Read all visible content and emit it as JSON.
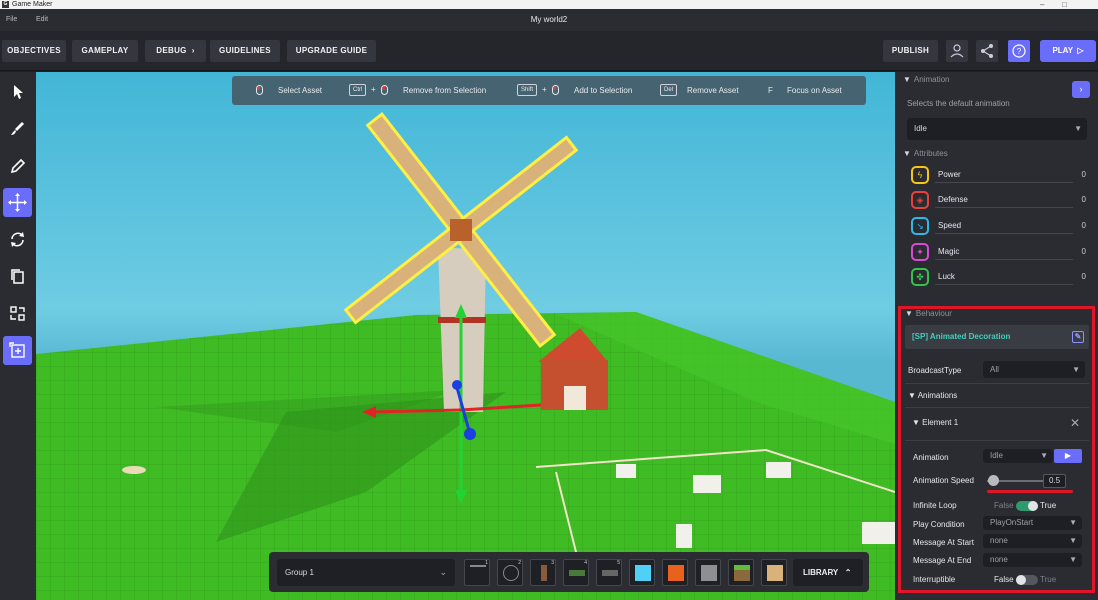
{
  "os": {
    "app_name": "Game Maker",
    "minimize": "–",
    "maximize": "□"
  },
  "menu": {
    "file": "File",
    "edit": "Edit",
    "document_title": "My world2"
  },
  "toolbar": {
    "objectives": "OBJECTIVES",
    "gameplay": "GAMEPLAY",
    "debug": "DEBUG",
    "guidelines": "GUIDELINES",
    "upgrade_guide": "UPGRADE GUIDE",
    "publish": "PUBLISH",
    "play": "PLAY",
    "accent": "#6a6dfa"
  },
  "tools": [
    "cursor-icon",
    "brush-icon",
    "eyedropper-icon",
    "move-icon",
    "rotate-icon",
    "duplicate-icon",
    "swap-icon",
    "add-group-icon"
  ],
  "hints": {
    "select": "Select Asset",
    "ctrl_key": "Ctrl",
    "remove_selection": "Remove from Selection",
    "shift_key": "Shift",
    "add_selection": "Add to Selection",
    "del_key": "Del",
    "remove_asset": "Remove Asset",
    "f_key": "F",
    "focus": "Focus on Asset"
  },
  "assetbar": {
    "group": "Group 1",
    "slot_numbers": [
      "1",
      "2",
      "3",
      "4",
      "5"
    ],
    "library": "LIBRARY"
  },
  "panel": {
    "animation": {
      "title": "Animation",
      "description": "Selects the default animation",
      "selected": "Idle"
    },
    "attributes": {
      "title": "Attributes",
      "items": [
        {
          "name": "Power",
          "value": "0",
          "color": "#f5c518",
          "icon": "lightning-icon"
        },
        {
          "name": "Defense",
          "value": "0",
          "color": "#e8413c",
          "icon": "shield-icon"
        },
        {
          "name": "Speed",
          "value": "0",
          "color": "#2fb7e6",
          "icon": "speed-icon"
        },
        {
          "name": "Magic",
          "value": "0",
          "color": "#d84ad1",
          "icon": "magic-icon"
        },
        {
          "name": "Luck",
          "value": "0",
          "color": "#33c24a",
          "icon": "clover-icon"
        }
      ]
    },
    "behaviour": {
      "title": "Behaviour",
      "name": "[SP] Animated Decoration",
      "broadcast_label": "BroadcastType",
      "broadcast_value": "All",
      "animations_label": "Animations",
      "element_label": "Element 1",
      "animation_label": "Animation",
      "animation_value": "Idle",
      "speed_label": "Animation Speed",
      "speed_value": "0.5",
      "loop_label": "Infinite Loop",
      "loop_false": "False",
      "loop_true": "True",
      "play_condition_label": "Play Condition",
      "play_condition_value": "PlayOnStart",
      "msg_start_label": "Message At Start",
      "msg_start_value": "none",
      "msg_end_label": "Message At End",
      "msg_end_value": "none",
      "interruptible_label": "Interruptible",
      "int_false": "False",
      "int_true": "True",
      "highlight": "#e0152a"
    }
  }
}
